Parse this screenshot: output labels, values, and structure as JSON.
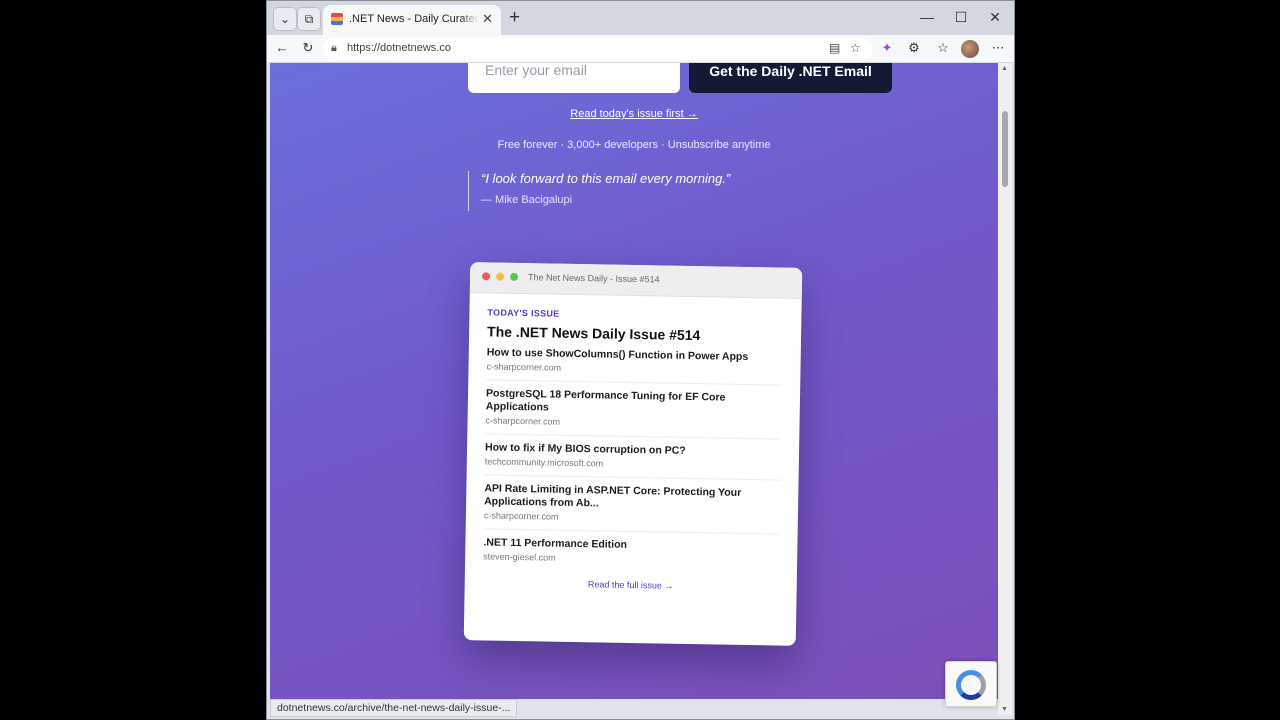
{
  "browser": {
    "tab_title": ".NET News - Daily Curated .NET Co",
    "tab_close": "✕",
    "new_tab": "+",
    "url": "https://dotnetnews.co",
    "status_url": "dotnetnews.co/archive/the-net-news-daily-issue-..."
  },
  "hero": {
    "email_placeholder": "Enter your email",
    "cta_label": "Get the Daily .NET Email",
    "read_link": "Read today's issue first →",
    "meta": "Free forever · 3,000+ developers · Unsubscribe anytime",
    "quote": "“I look forward to this email every morning.”",
    "quote_author": "— Mike Bacigalupi"
  },
  "card": {
    "window_title": "The Net News Daily - Issue #514",
    "label": "TODAY'S ISSUE",
    "title": "The .NET News Daily Issue #514",
    "items": [
      {
        "title": "How to use ShowColumns() Function in Power Apps",
        "source": "c-sharpcorner.com"
      },
      {
        "title": "PostgreSQL 18 Performance Tuning for EF Core Applications",
        "source": "c-sharpcorner.com"
      },
      {
        "title": "How to fix if My BIOS corruption on PC?",
        "source": "techcommunity.microsoft.com"
      },
      {
        "title": "API Rate Limiting in ASP.NET Core: Protecting Your Applications from Ab...",
        "source": "c-sharpcorner.com"
      },
      {
        "title": ".NET 11 Performance Edition",
        "source": "steven-giesel.com"
      }
    ],
    "full_link": "Read the full issue →"
  },
  "colors": {
    "gradient_start": "#6a6fdc",
    "gradient_end": "#7b4fb7",
    "cta_bg": "#141a33",
    "accent": "#4a3fc7"
  }
}
